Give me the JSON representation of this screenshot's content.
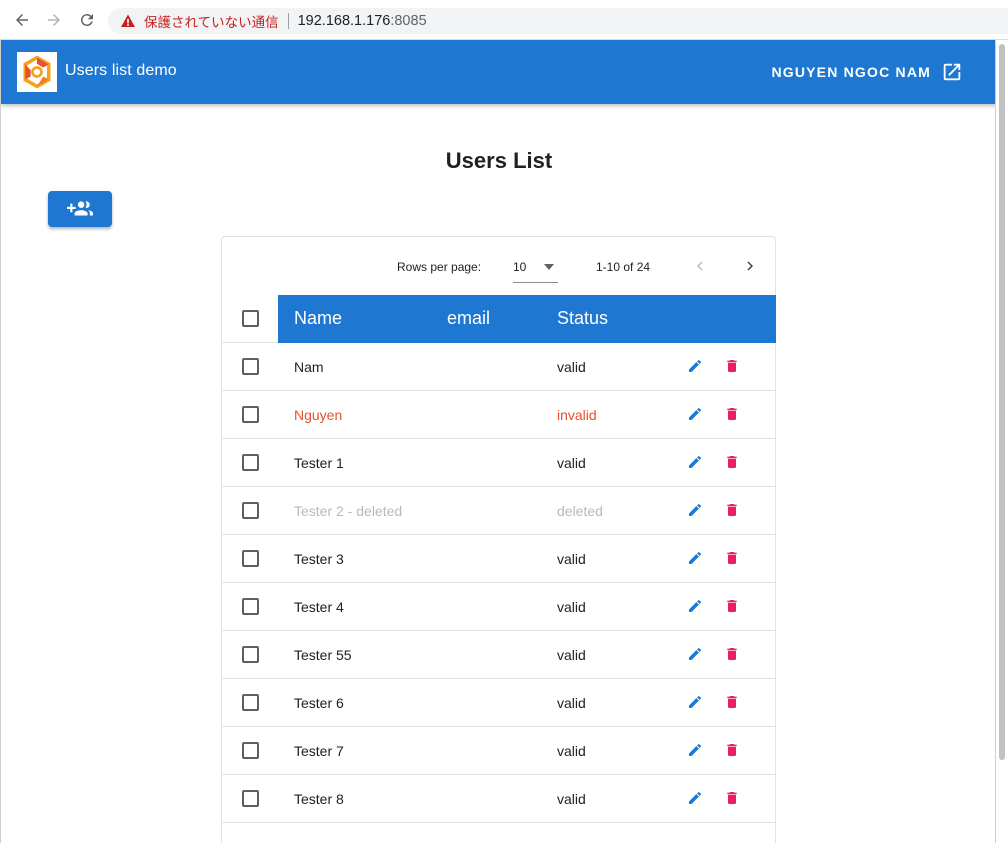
{
  "browser": {
    "security_warning": "保護されていない通信",
    "url_host": "192.168.1.176",
    "url_port": ":8085"
  },
  "appbar": {
    "title": "Users list demo",
    "user_name": "NGUYEN NGOC NAM"
  },
  "page": {
    "title": "Users List"
  },
  "pagination": {
    "rows_label": "Rows per page:",
    "rows_value": "10",
    "page_info": "1-10 of 24"
  },
  "table": {
    "headers": {
      "name": "Name",
      "email": "email",
      "status": "Status"
    },
    "rows": [
      {
        "name": "Nam",
        "status": "valid"
      },
      {
        "name": "Nguyen",
        "status": "invalid"
      },
      {
        "name": "Tester 1",
        "status": "valid"
      },
      {
        "name": "Tester 2 - deleted",
        "status": "deleted"
      },
      {
        "name": "Tester 3",
        "status": "valid"
      },
      {
        "name": "Tester 4",
        "status": "valid"
      },
      {
        "name": "Tester 55",
        "status": "valid"
      },
      {
        "name": "Tester 6",
        "status": "valid"
      },
      {
        "name": "Tester 7",
        "status": "valid"
      },
      {
        "name": "Tester 8",
        "status": "valid"
      }
    ]
  },
  "colors": {
    "primary": "#1e78d2",
    "invalid": "#e8502e",
    "deleted": "#b9b9b9",
    "delete_icon": "#e91e63"
  }
}
